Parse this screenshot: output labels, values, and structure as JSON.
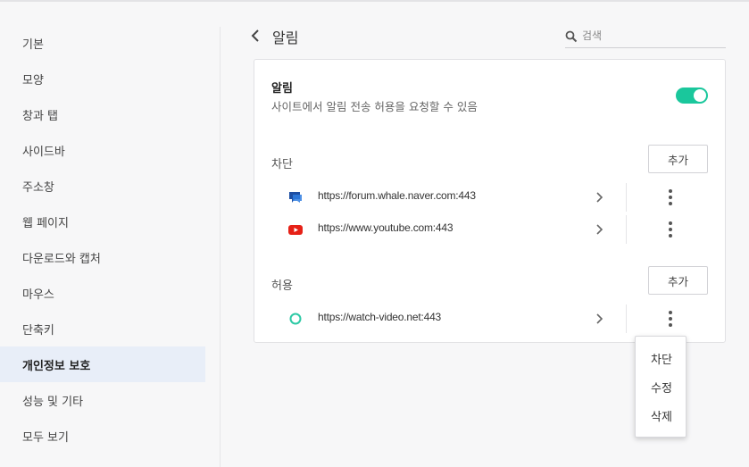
{
  "sidebar": {
    "items": [
      {
        "label": "기본",
        "active": false
      },
      {
        "label": "모양",
        "active": false
      },
      {
        "label": "창과 탭",
        "active": false
      },
      {
        "label": "사이드바",
        "active": false
      },
      {
        "label": "주소창",
        "active": false
      },
      {
        "label": "웹 페이지",
        "active": false
      },
      {
        "label": "다운로드와 캡처",
        "active": false
      },
      {
        "label": "마우스",
        "active": false
      },
      {
        "label": "단축키",
        "active": false
      },
      {
        "label": "개인정보 보호",
        "active": true
      },
      {
        "label": "성능 및 기타",
        "active": false
      },
      {
        "label": "모두 보기",
        "active": false
      }
    ]
  },
  "header": {
    "title": "알림",
    "search_placeholder": "검색"
  },
  "notifications": {
    "title": "알림",
    "description": "사이트에서 알림 전송 허용을 요청할 수 있음",
    "enabled": true,
    "accent_color": "#1ac79c"
  },
  "blocked": {
    "label": "차단",
    "add_label": "추가",
    "sites": [
      {
        "url": "https://forum.whale.naver.com:443",
        "icon": "whale-forum-icon"
      },
      {
        "url": "https://www.youtube.com:443",
        "icon": "youtube-icon"
      }
    ]
  },
  "allowed": {
    "label": "허용",
    "add_label": "추가",
    "sites": [
      {
        "url": "https://watch-video.net:443",
        "icon": "circle-outline-icon"
      }
    ]
  },
  "context_menu": {
    "items": [
      "차단",
      "수정",
      "삭제"
    ]
  }
}
